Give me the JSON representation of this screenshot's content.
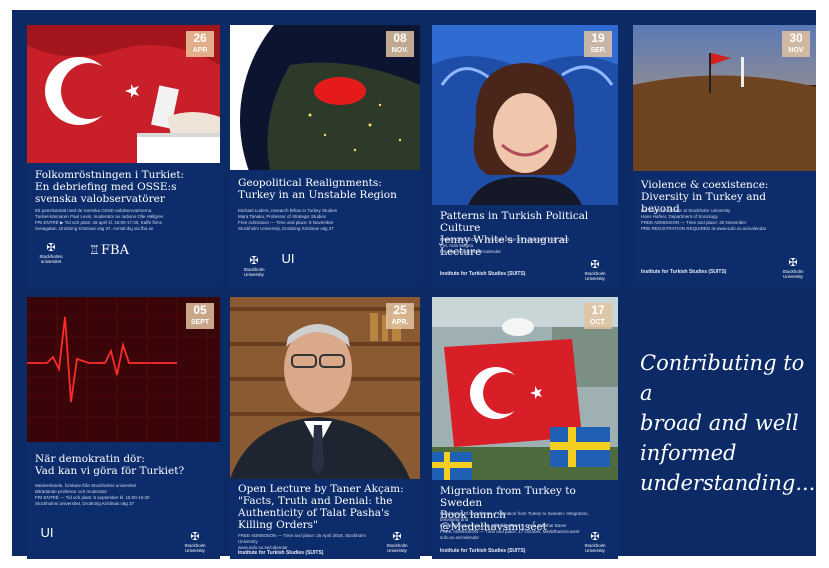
{
  "cards": [
    {
      "day": "26",
      "month": "APR",
      "title": "Folkomröstningen i Turkiet:\nEn debriefing med OSSE:s svenska valobservatörer",
      "body": "Ett panelsamtal med de svenska OSSE-valobservatörerna.\nTurkiet-kännaren Paul Levin, moderator av radions Olle Hällgren\nFRI ENTRÉ ▶ Tid och plats: 26 april kl. 16:00-17:30, Kaffe finns\nSveagatan, Drottning Kristinas väg 37. Anmäl dig via fba.se",
      "logos": [
        "Stockholms universitet",
        "FBA"
      ]
    },
    {
      "day": "08",
      "month": "NOV.",
      "title": "Geopolitical Realignments:\nTurkey in an Unstable Region",
      "body": "Michael Lüders, research fellow in Turkey Studies\nMara Tanaka, Professor of Strategic Studies\nFree Admission — Time and place: 8 November\nStockholm University, Drottning Kristinas väg 37",
      "logos": [
        "Stockholm University",
        "UI"
      ]
    },
    {
      "day": "19",
      "month": "SEP.",
      "title": "Patterns in Turkish Political Culture\nJenny White's Inaugural Lecture",
      "body": "FREE ADMISSION — Time and place: 19 September 2017, 3:00 PM, Aula Magna\nhttp://www.sufo.su.se/calendar",
      "foot": "Institute for Turkish Studies (SUITS)",
      "logos": [
        "Stockholm University"
      ]
    },
    {
      "day": "30",
      "month": "NOV",
      "title": "Violence & coexistence:\nDiversity in Turkey and beyond",
      "body": "Ian Burns, Professor at Stockholm University\nHans Hafner, Department of Sociology\nFREE ADMISSION — Time and place: 30 November\nPRE-REGISTRATION REQUIRED at www.sufo.su.se/calendar",
      "foot": "Institute for Turkish Studies (SUITS)",
      "logos": [
        "Stockholm University"
      ]
    },
    {
      "day": "05",
      "month": "SEPT",
      "title": "När demokratin dör:\nVad kan vi göra för Turkiet?",
      "body": "Medverkande, forskare från Stockholms universitet\nBiträdande professor och moderator\nFRI ENTRÉ — Tid och plats: 5 september kl. 15:00-16:30\nStockholms universitet, Drottning Kristinas väg 37",
      "logos": [
        "UI",
        "Stockholm University"
      ]
    },
    {
      "day": "25",
      "month": "APR.",
      "title": "Open Lecture by Taner Akçam:\n\"Facts, Truth and Denial: the\nAuthenticity of Talat Pasha's\nKilling Orders\"",
      "body": "FREE ADMISSION — Time and place: 25 April 2018, Stockholm University\nwww.sufo.su.se/calendar",
      "foot": "Institute for Turkish Studies (SUITS)",
      "logos": [
        "Stockholm University"
      ]
    },
    {
      "day": "17",
      "month": "OCT.",
      "title": "Migration from Turkey to Sweden\nBook launch @Medelhavsmuséet",
      "body": "Celebration of the release of Migration from Turkey to Sweden: Integration, belonging and\ntransnational community, edited by Paul T. Levin & Bahar Baser\nFREE ADMISSION — Time and place: 17 October, Medelhavsmuseet\nsufo.su.se/calendar",
      "foot": "Institute for Turkish Studies (SUITS)",
      "logos": [
        "Stockholm University"
      ]
    }
  ],
  "tagline": "Contributing to a\nbroad and well\ninformed\nunderstanding..."
}
